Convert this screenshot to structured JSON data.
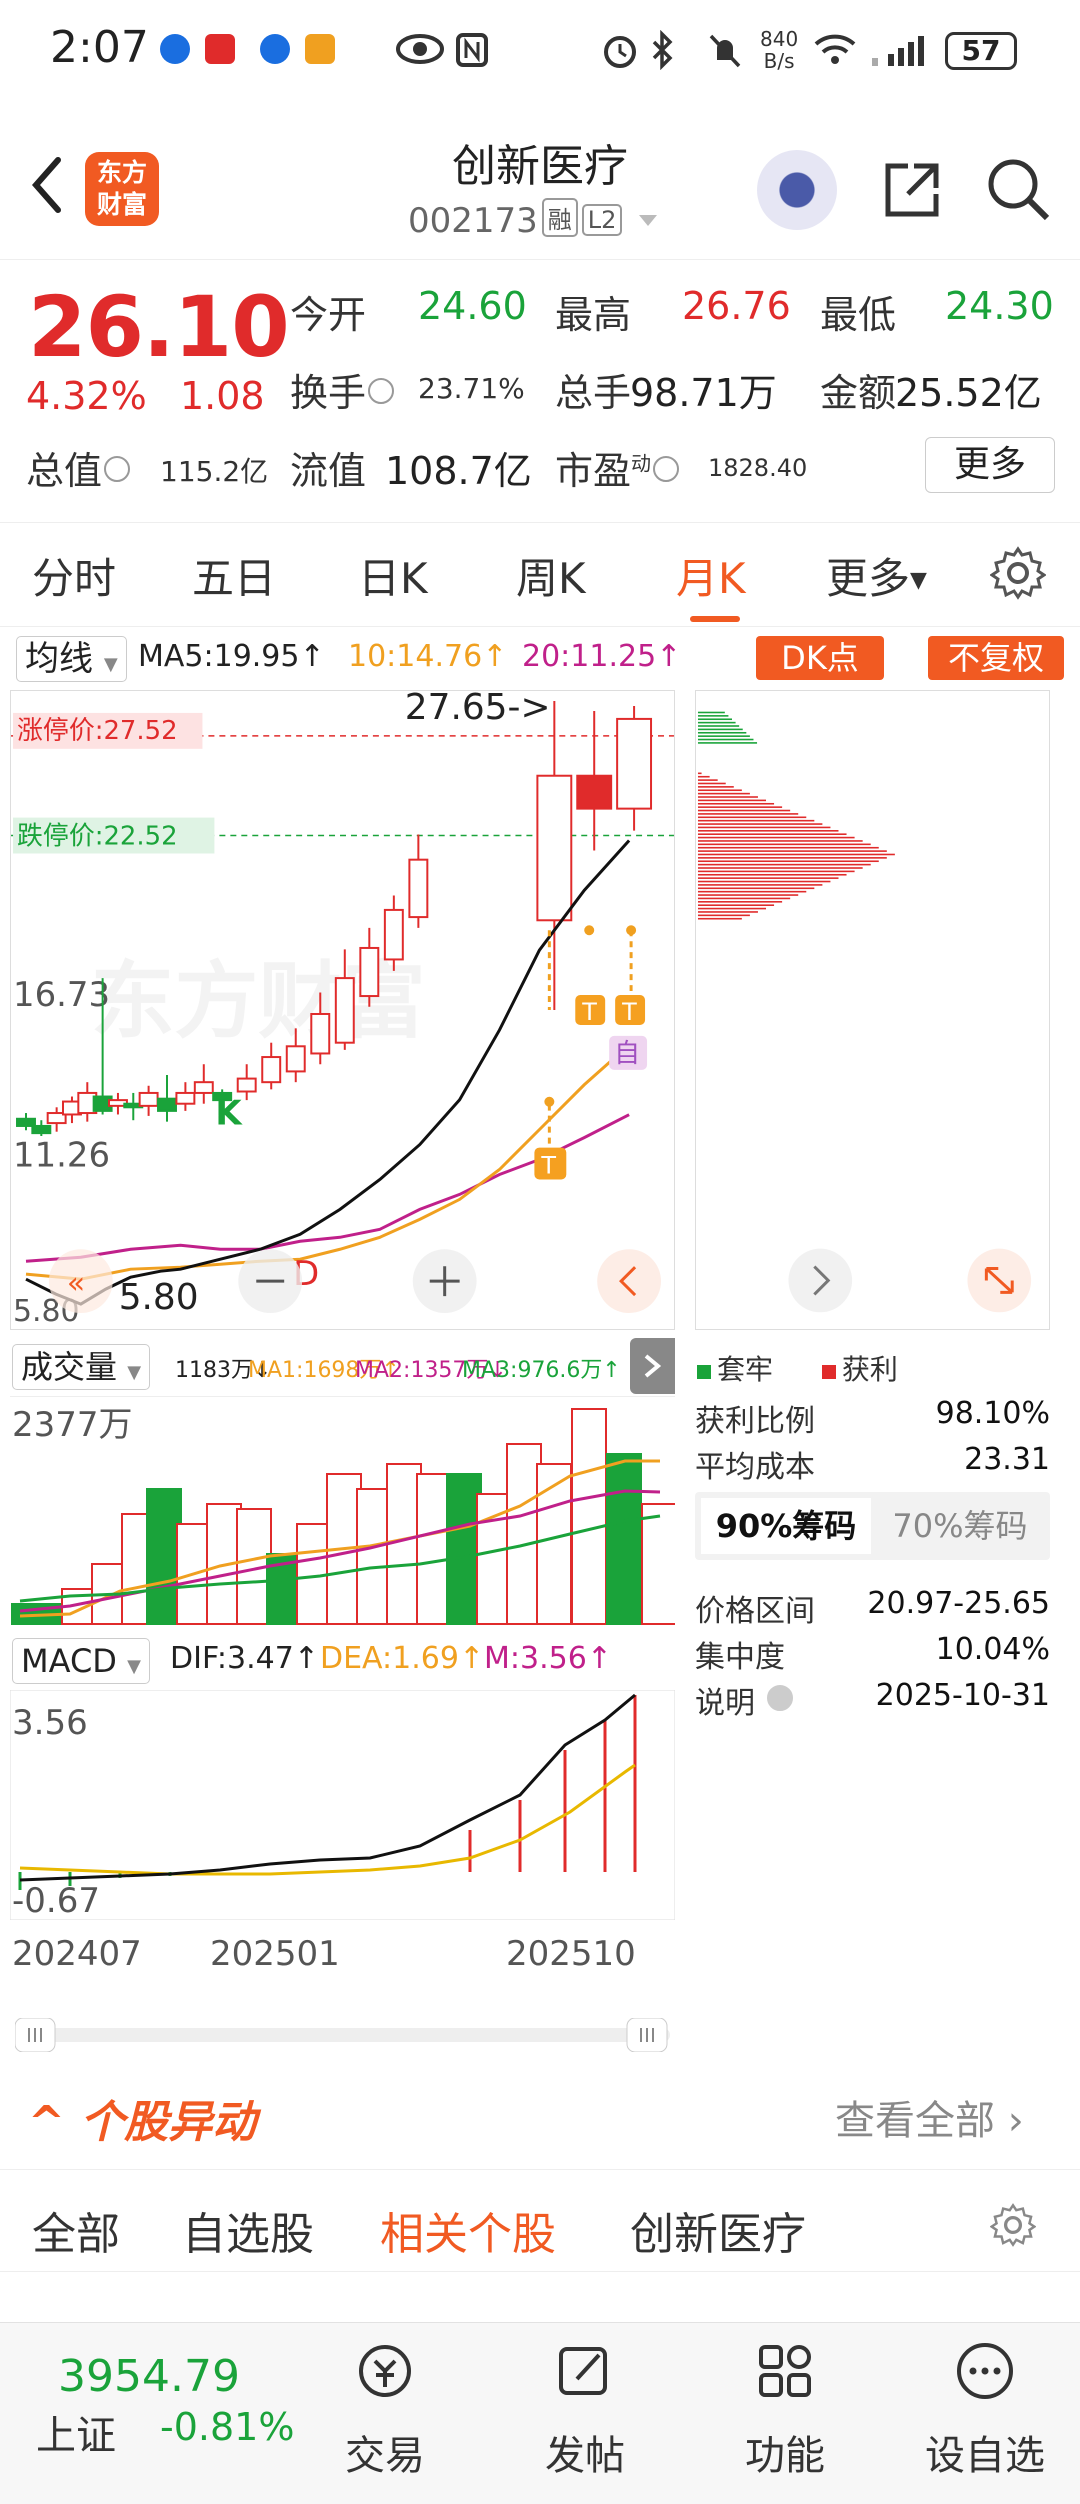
{
  "status_bar": {
    "time": "2:07",
    "net_speed_top": "840",
    "net_speed_bottom": "B/s",
    "battery": "57"
  },
  "header": {
    "title": "创新医疗",
    "code": "002173",
    "tag_margin": "融",
    "tag_level": "L2",
    "logo_line1": "东方",
    "logo_line2": "财富"
  },
  "quote": {
    "price": "26.10",
    "change_pct": "4.32%",
    "change": "1.08",
    "open_label": "今开",
    "open": "24.60",
    "high_label": "最高",
    "high": "26.76",
    "low_label": "最低",
    "low": "24.30",
    "turnover_label": "换手",
    "turnover": "23.71%",
    "volume_label": "总手",
    "volume": "98.71万",
    "amount_label": "金额",
    "amount": "25.52亿",
    "mktcap_label": "总值",
    "mktcap": "115.2亿",
    "float_label": "流值",
    "float_cap": "108.7亿",
    "pe_label": "市盈",
    "pe_sup": "动",
    "pe": "1828.40",
    "more": "更多"
  },
  "tabs": [
    {
      "label": "分时"
    },
    {
      "label": "五日"
    },
    {
      "label": "日K"
    },
    {
      "label": "周K"
    },
    {
      "label": "月K"
    },
    {
      "label": "更多"
    }
  ],
  "ma_row": {
    "selector": "均线",
    "ma5": "MA5:19.95↑",
    "ma10": "10:14.76↑",
    "ma20": "20:11.25↑",
    "dk": "DK点",
    "fq": "不复权"
  },
  "kline": {
    "limit_up": "涨停价:27.52",
    "limit_down": "跌停价:22.52",
    "y_labels": [
      "16.73",
      "11.26",
      "5.80"
    ],
    "high_marker": "27.65->",
    "low_marker": "5.80",
    "watermark": "东方财富",
    "signal_k": "K",
    "signal_d": "D",
    "tag_t": "T",
    "tag_zi": "自"
  },
  "chips": {
    "legend_trapped": "套牢",
    "legend_profit": "获利",
    "profit_ratio_label": "获利比例",
    "profit_ratio": "98.10%",
    "avg_cost_label": "平均成本",
    "avg_cost": "23.31",
    "tab90": "90%筹码",
    "tab70": "70%筹码",
    "range_label": "价格区间",
    "range": "20.97-25.65",
    "concentration_label": "集中度",
    "concentration": "10.04%",
    "note_label": "说明",
    "note_date": "2025-10-31"
  },
  "volume": {
    "selector": "成交量",
    "v": "1183万↓",
    "ma1": "MA1:1698万↑",
    "ma2": "MA2:1357万↓",
    "ma3": "MA3:976.6万↑",
    "max_label": "2377万"
  },
  "macd": {
    "selector": "MACD",
    "dif": "DIF:3.47↑",
    "dea": "DEA:1.69↑",
    "m": "M:3.56↑",
    "top_label": "3.56",
    "bottom_label": "-0.67"
  },
  "x_axis": [
    "202407",
    "202501",
    "202510"
  ],
  "movement": {
    "title": "个股异动",
    "view_all": "查看全部"
  },
  "sub_tabs": [
    {
      "label": "全部"
    },
    {
      "label": "自选股"
    },
    {
      "label": "相关个股"
    },
    {
      "label": "创新医疗"
    }
  ],
  "bottom": {
    "index_value": "3954.79",
    "index_name": "上证",
    "index_pct": "-0.81%",
    "items": [
      {
        "label": "交易"
      },
      {
        "label": "发帖"
      },
      {
        "label": "功能"
      },
      {
        "label": "设自选"
      }
    ]
  },
  "colors": {
    "up": "#e02b2b",
    "down": "#1aa33a",
    "accent": "#f15a22",
    "ma10": "#f0a020",
    "ma20": "#c0208a"
  }
}
